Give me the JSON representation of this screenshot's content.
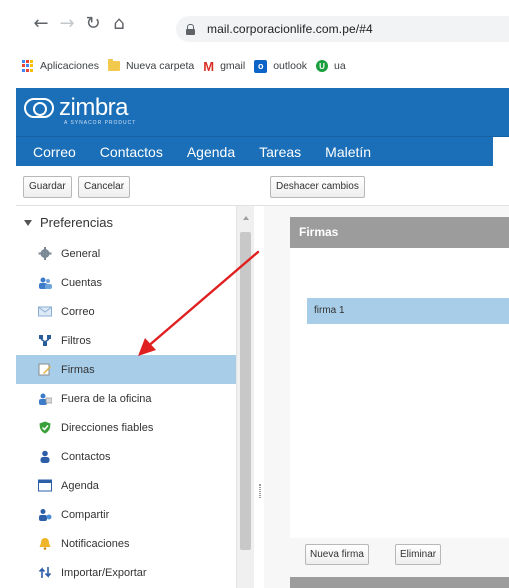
{
  "browser": {
    "url": "mail.corporacionlife.com.pe/#4",
    "nav": {
      "back": "←",
      "forward": "→",
      "reload": "↻",
      "home": "⌂"
    }
  },
  "bookmarks": [
    {
      "label": "Aplicaciones",
      "icon": "apps-grid-icon"
    },
    {
      "label": "Nueva carpeta",
      "icon": "folder-icon"
    },
    {
      "label": "gmail",
      "icon": "gmail-icon"
    },
    {
      "label": "outlook",
      "icon": "outlook-icon"
    },
    {
      "label": "ua",
      "icon": "ua-icon"
    }
  ],
  "app": {
    "brand": "zimbra",
    "brand_sub": "A SYNACOR PRODUCT",
    "accent": "#1a6fb8",
    "tabs": [
      {
        "label": "Correo"
      },
      {
        "label": "Contactos"
      },
      {
        "label": "Agenda"
      },
      {
        "label": "Tareas"
      },
      {
        "label": "Maletín"
      }
    ]
  },
  "toolbar": {
    "save_label": "Guardar",
    "cancel_label": "Cancelar",
    "undo_label": "Deshacer cambios"
  },
  "sidebar": {
    "root_label": "Preferencias",
    "items": [
      {
        "label": "General",
        "icon": "gear-icon"
      },
      {
        "label": "Cuentas",
        "icon": "accounts-icon"
      },
      {
        "label": "Correo",
        "icon": "mail-icon"
      },
      {
        "label": "Filtros",
        "icon": "filter-icon"
      },
      {
        "label": "Firmas",
        "icon": "signature-icon",
        "selected": true
      },
      {
        "label": "Fuera de la oficina",
        "icon": "out-of-office-icon"
      },
      {
        "label": "Direcciones fiables",
        "icon": "shield-icon"
      },
      {
        "label": "Contactos",
        "icon": "contact-icon"
      },
      {
        "label": "Agenda",
        "icon": "calendar-icon"
      },
      {
        "label": "Compartir",
        "icon": "share-icon"
      },
      {
        "label": "Notificaciones",
        "icon": "bell-icon"
      },
      {
        "label": "Importar/Exportar",
        "icon": "import-export-icon"
      }
    ]
  },
  "signatures": {
    "header": "Firmas",
    "items": [
      {
        "label": "firma 1",
        "selected": true
      }
    ],
    "new_label": "Nueva firma",
    "delete_label": "Eliminar"
  },
  "annotation": {
    "color": "#e02020"
  }
}
